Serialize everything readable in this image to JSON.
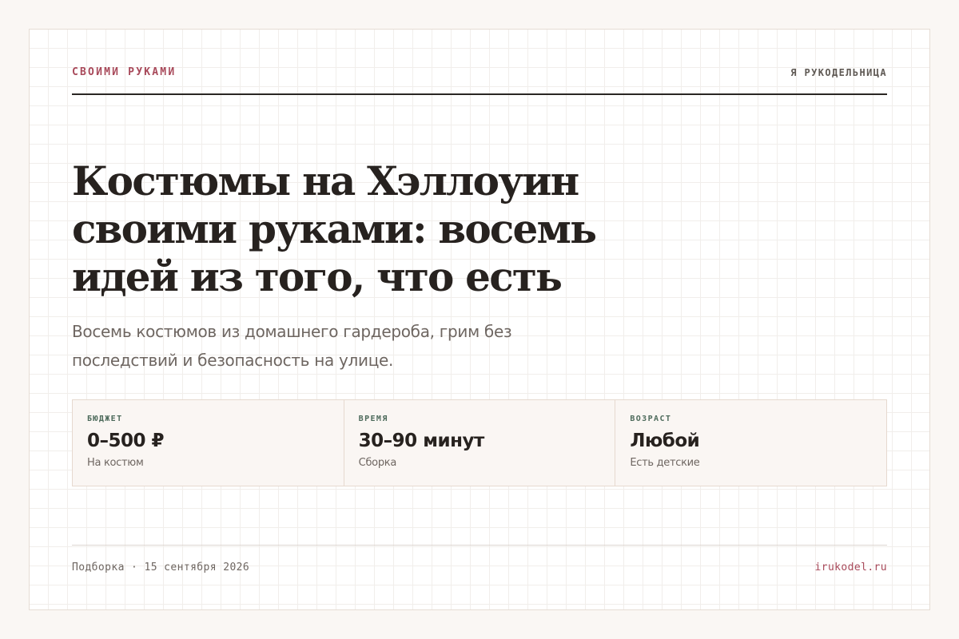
{
  "header": {
    "rubric": "СВОИМИ РУКАМИ",
    "brand": "Я РУКОДЕЛЬНИЦА"
  },
  "article": {
    "title": "Костюмы на Хэллоуин своими руками: восемь идей из того, что есть",
    "lede": "Восемь костюмов из домашнего гардероба, грим без последствий и безопасность на улице."
  },
  "stats": [
    {
      "label": "БЮДЖЕТ",
      "value": "0–500 ₽",
      "note": "На костюм"
    },
    {
      "label": "ВРЕМЯ",
      "value": "30–90 минут",
      "note": "Сборка"
    },
    {
      "label": "ВОЗРАСТ",
      "value": "Любой",
      "note": "Есть детские"
    }
  ],
  "footer": {
    "meta": "Подборка · 15 сентября 2026",
    "domain": "irukodel.ru"
  },
  "colors": {
    "accent": "#a8495a",
    "label_green": "#4e6b5c",
    "ink": "#27221f",
    "muted": "#6e6661",
    "page_bg": "#faf7f4"
  }
}
